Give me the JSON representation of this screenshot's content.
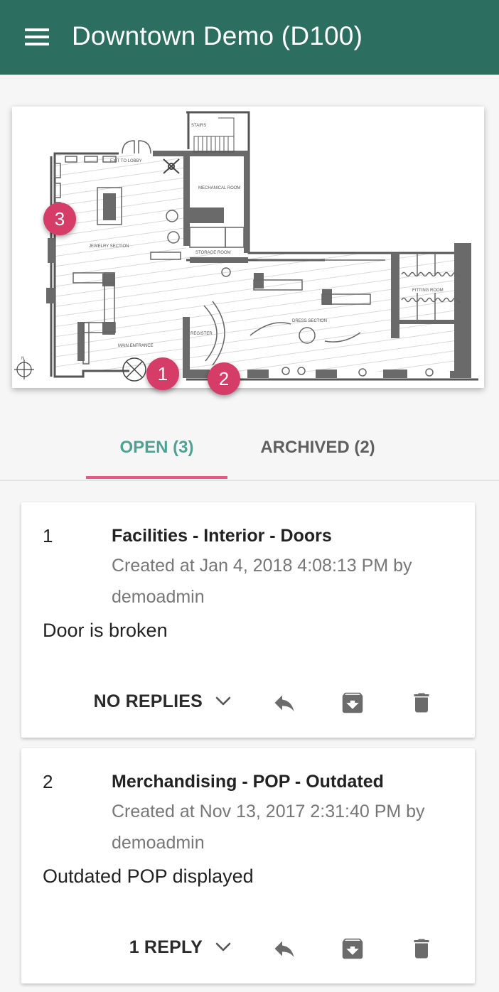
{
  "appbar": {
    "title": "Downtown Demo (D100)",
    "menu_icon": "hamburger-menu-icon"
  },
  "floorplan": {
    "labels": {
      "stairs": "STAIRS",
      "exit_to_lobby": "EXIT TO LOBBY",
      "mechanical_room": "MECHANICAL ROOM",
      "jewelry_section": "JEWELRY SECTION",
      "storage_room": "STORAGE ROOM",
      "fitting_room": "FITTING ROOM",
      "register": "REGISTER",
      "dress_section": "DRESS SECTION",
      "main_entrance": "MAIN ENTRANCE",
      "north": "N"
    },
    "pins": [
      "3",
      "1",
      "2"
    ],
    "pin_color": "#d63c68"
  },
  "tabs": [
    {
      "label": "OPEN (3)",
      "active": true
    },
    {
      "label": "ARCHIVED (2)",
      "active": false
    }
  ],
  "issues": [
    {
      "number": "1",
      "category": "Facilities - Interior - Doors",
      "meta": "Created at Jan 4, 2018 4:08:13 PM by demoadmin",
      "description": "Door is broken",
      "replies_label": "NO REPLIES"
    },
    {
      "number": "2",
      "category": "Merchandising - POP - Outdated",
      "meta": "Created at Nov 13, 2017 2:31:40 PM by demoadmin",
      "description": "Outdated POP displayed",
      "replies_label": "1 REPLY"
    }
  ],
  "colors": {
    "appbar": "#2c6e5f",
    "tab_active": "#4fa293",
    "tab_indicator": "#e35b81"
  },
  "icons": [
    "chevron-down-icon",
    "reply-icon",
    "archive-icon",
    "delete-icon"
  ]
}
